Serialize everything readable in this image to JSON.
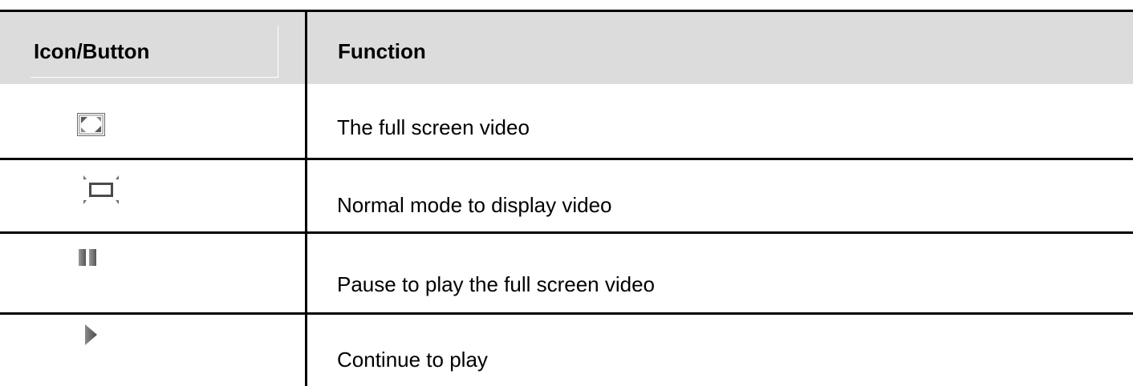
{
  "header": {
    "icon_column": "Icon/Button",
    "function_column": "Function"
  },
  "rows": [
    {
      "icon": "fullscreen-icon",
      "function": "The full screen video"
    },
    {
      "icon": "normal-mode-icon",
      "function": "Normal mode to display video"
    },
    {
      "icon": "pause-icon",
      "function": "Pause to play the full screen video"
    },
    {
      "icon": "play-icon",
      "function": "Continue to play"
    }
  ],
  "colors": {
    "header_background": "#dcdcdc",
    "grid_lines": "#000000",
    "icon_gray": "#6e6e6e"
  }
}
